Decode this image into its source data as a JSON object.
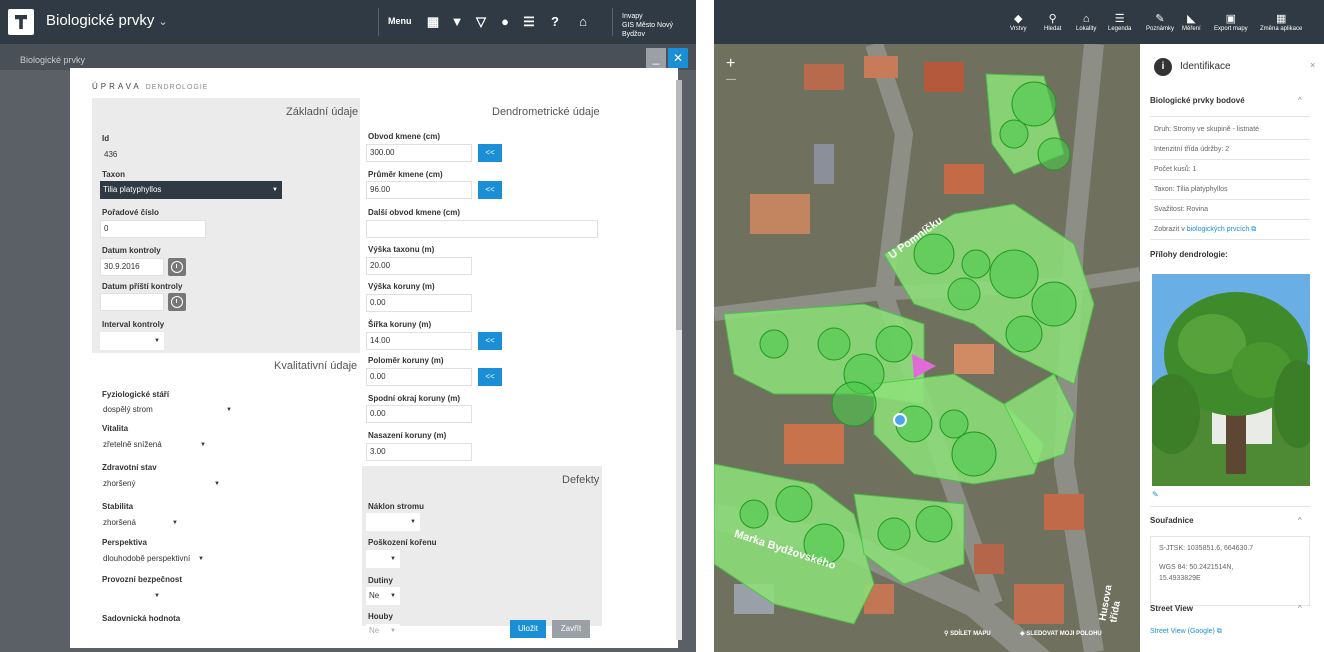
{
  "left_app": {
    "title": "Biologické prvky",
    "chevron": "⌄",
    "menu_label": "Menu",
    "brand_line1": "Invapy",
    "brand_line2": "GIS Město Nový Bydžov",
    "strip_text": "Biologické prvky",
    "dialog": {
      "heading": "ÚPRAVA",
      "heading_sub": "DENDROLOGIE",
      "sections": {
        "basic": "Základní údaje",
        "dendro": "Dendrometrické údaje",
        "quality": "Kvalitativní údaje",
        "defects": "Defekty"
      },
      "fields": {
        "id_label": "Id",
        "id_value": "436",
        "taxon_label": "Taxon",
        "taxon_value": "Tilia platyphyllos",
        "order_label": "Pořadové číslo",
        "order_value": "0",
        "date_label": "Datum kontroly",
        "date_value": "30.9.2016",
        "next_date_label": "Datum příští kontroly",
        "next_date_value": "",
        "interval_label": "Interval kontroly",
        "interval_value": "",
        "girth_label": "Obvod kmene (cm)",
        "girth_value": "300.00",
        "diameter_label": "Průměr kmene (cm)",
        "diameter_value": "96.00",
        "other_girth_label": "Další obvod kmene (cm)",
        "other_girth_value": "",
        "height_label": "Výška taxonu (m)",
        "height_value": "20.00",
        "crown_height_label": "Výška koruny (m)",
        "crown_height_value": "0.00",
        "crown_width_label": "Šířka koruny (m)",
        "crown_width_value": "14.00",
        "crown_radius_label": "Poloměr koruny (m)",
        "crown_radius_value": "0.00",
        "crown_lower_label": "Spodní okraj koruny (m)",
        "crown_lower_value": "0.00",
        "crown_base_label": "Nasazení koruny (m)",
        "crown_base_value": "3.00",
        "phys_label": "Fyziologické stáří",
        "phys_value": "dospělý strom",
        "vitality_label": "Vitalita",
        "vitality_value": "zřetelně snížená",
        "health_label": "Zdravotní stav",
        "health_value": "zhoršený",
        "stability_label": "Stabilita",
        "stability_value": "zhoršená",
        "perspective_label": "Perspektiva",
        "perspective_value": "dlouhodobě perspektivní",
        "safety_label": "Provozní bezpečnost",
        "safety_value": "",
        "garden_label": "Sadovnická hodnota",
        "tilt_label": "Náklon stromu",
        "tilt_value": "",
        "root_label": "Poškození kořenu",
        "root_value": "",
        "cavities_label": "Dutiny",
        "cavities_value": "Ne",
        "fungi_label": "Houby",
        "fungi_value": "Ne"
      },
      "copy_label": "<<",
      "save_label": "Uložit",
      "close_label": "Zavřít"
    }
  },
  "right_app": {
    "toolbar": [
      {
        "icon": "layers-icon",
        "glyph": "◆",
        "label": "Vrstvy"
      },
      {
        "icon": "search-icon",
        "glyph": "⚲",
        "label": "Hledat"
      },
      {
        "icon": "location-icon",
        "glyph": "⌂",
        "label": "Lokality"
      },
      {
        "icon": "legend-icon",
        "glyph": "☰",
        "label": "Legenda"
      },
      {
        "icon": "note-icon",
        "glyph": "✎",
        "label": "Poznámky"
      },
      {
        "icon": "measure-icon",
        "glyph": "◣",
        "label": "Měření"
      },
      {
        "icon": "print-icon",
        "glyph": "▣",
        "label": "Export mapy"
      },
      {
        "icon": "apps-icon",
        "glyph": "▦",
        "label": "Změna aplikace"
      }
    ],
    "zoom_in": "+",
    "zoom_out": "—",
    "streets": [
      "U Pomníčku",
      "Marka Bydžovského",
      "Husova třída"
    ],
    "share_label": "SDÍLET MAPU",
    "track_label": "SLEDOVAT MOJI POLOHU",
    "identify": {
      "title": "Identifikace",
      "info_glyph": "i",
      "close": "×",
      "bio_head": "Biologické prvky bodové",
      "rows": [
        "Druh: Stromy ve skupině - listnaté",
        "Intenzitní třída údržby: 2",
        "Počet kusů: 1",
        "Taxon: Tilia platyphyllos",
        "Svažitost: Rovina"
      ],
      "show_prefix": "Zobrazit v ",
      "show_link": "biologických prvcích",
      "attach_label": "Přílohy dendrologie:",
      "coords_head": "Souřadnice",
      "coord_sjtsk": "S-JTSK: 1035851.6, 664630.7",
      "coord_wgs_1": "WGS 84: 50.2421514N,",
      "coord_wgs_2": "15.4933829E",
      "sv_head": "Street View",
      "sv_link": "Street View (Google)"
    }
  }
}
